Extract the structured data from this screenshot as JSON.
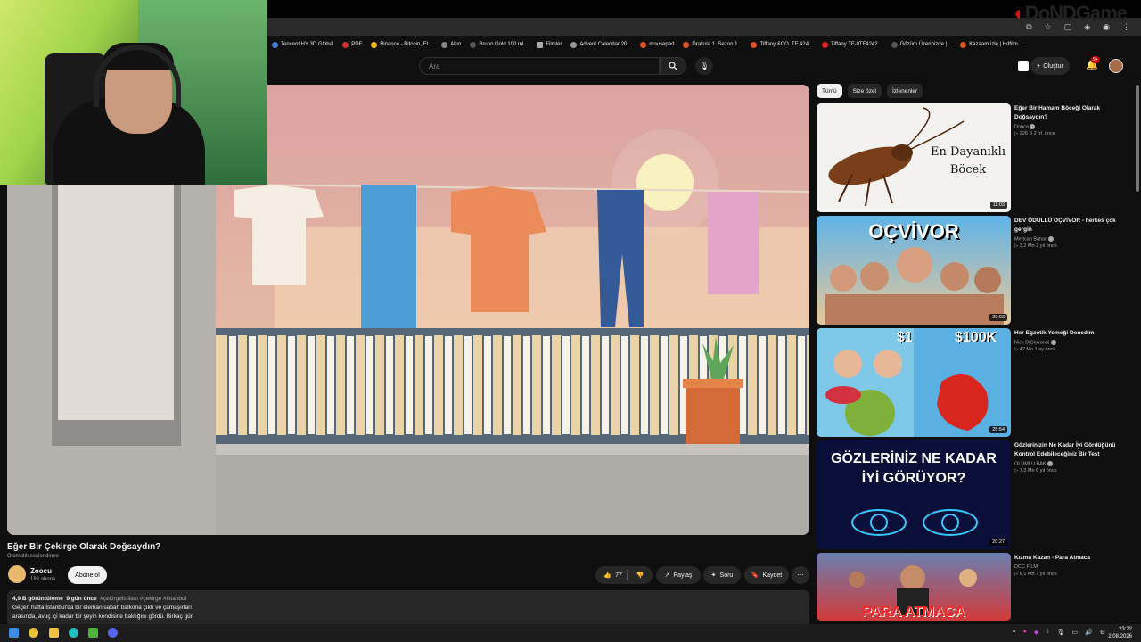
{
  "browser": {
    "bookmarks": [
      "x",
      "Tencent HY 3D Global",
      "PDF",
      "Binance - Bitcoin, Et...",
      "Altın",
      "Bruno Gold 100 ml...",
      "Filmler",
      "Advent Calendar 20...",
      "mousepad",
      "Drakula 1. Sezon 1...",
      "Tiffany &CO. TF 424...",
      "Tiffany TF-0TF4242...",
      "Gözüm Üzerinizde |...",
      "Kazaam izle | Hdfilm..."
    ],
    "watermark": "DoNDGame"
  },
  "header": {
    "search_placeholder": "Ara",
    "create_label": "Oluştur",
    "notif_count": "9+"
  },
  "video": {
    "title": "Eğer Bir Çekirge Olarak Doğsaydın?",
    "auto_dub": "Otomatik seslendirme",
    "channel": "Zoocu",
    "subscribers": "183 abone",
    "subscribe_label": "Abone ol",
    "likes": "77",
    "share_label": "Paylaş",
    "ask_label": "Soru",
    "save_label": "Kaydet",
    "views": "4,9 B görüntüleme",
    "age": "9 gün önce",
    "tags": "#çekirgeistilası #çekirge #istanbul",
    "desc_line1": "Geçen hafta İstanbul'da bir eleman sabah balkona çıktı ve çamaşırları",
    "desc_line2": "arasında, avuç içi kadar bir şeyin kendisine baktığını gördü. Birkaç gün"
  },
  "chips": [
    "Tümü",
    "Size özel",
    "İzlenenler"
  ],
  "recommendations": [
    {
      "title": "Eğer Bir Hamam Böceği Olarak Doğsaydın?",
      "channel": "Donca",
      "meta": "226 B  2 hf. önce",
      "duration": "11:03",
      "thumb_text": "En Dayanıklı Böcek"
    },
    {
      "title": "DEV ÖDÜLLÜ OÇVİVOR - herkes çok gergin",
      "channel": "Mertcan Bahar",
      "meta": "3,2 Mn  2 yıl önce",
      "duration": "20:02",
      "thumb_text": "OÇVİVOR"
    },
    {
      "title": "Her Egzotik Yemeği Denedim",
      "channel": "Nick DiGiovanni",
      "meta": "42 Mn  1 ay önce",
      "duration": "25:54",
      "thumb_text_left": "$1",
      "thumb_text_right": "$100K"
    },
    {
      "title": "Gözlerinizin Ne Kadar İyi Gördüğünü Kontrol Edebileceğiniz Bir Test",
      "channel": "OLUMLU BAK",
      "meta": "7,3 Mn  6 yıl önce",
      "duration": "20:27",
      "thumb_text": "GÖZLERİNİZ NE KADAR İYİ GÖRÜYOR?"
    },
    {
      "title": "Kızma Kazan - Para Atmaca",
      "channel": "DCC FILM",
      "meta": "6,1 Mn  7 yıl önce",
      "duration": "",
      "thumb_text": "PARA ATMACA"
    }
  ],
  "taskbar": {
    "time": "23:22",
    "date": "2.08.2026"
  }
}
